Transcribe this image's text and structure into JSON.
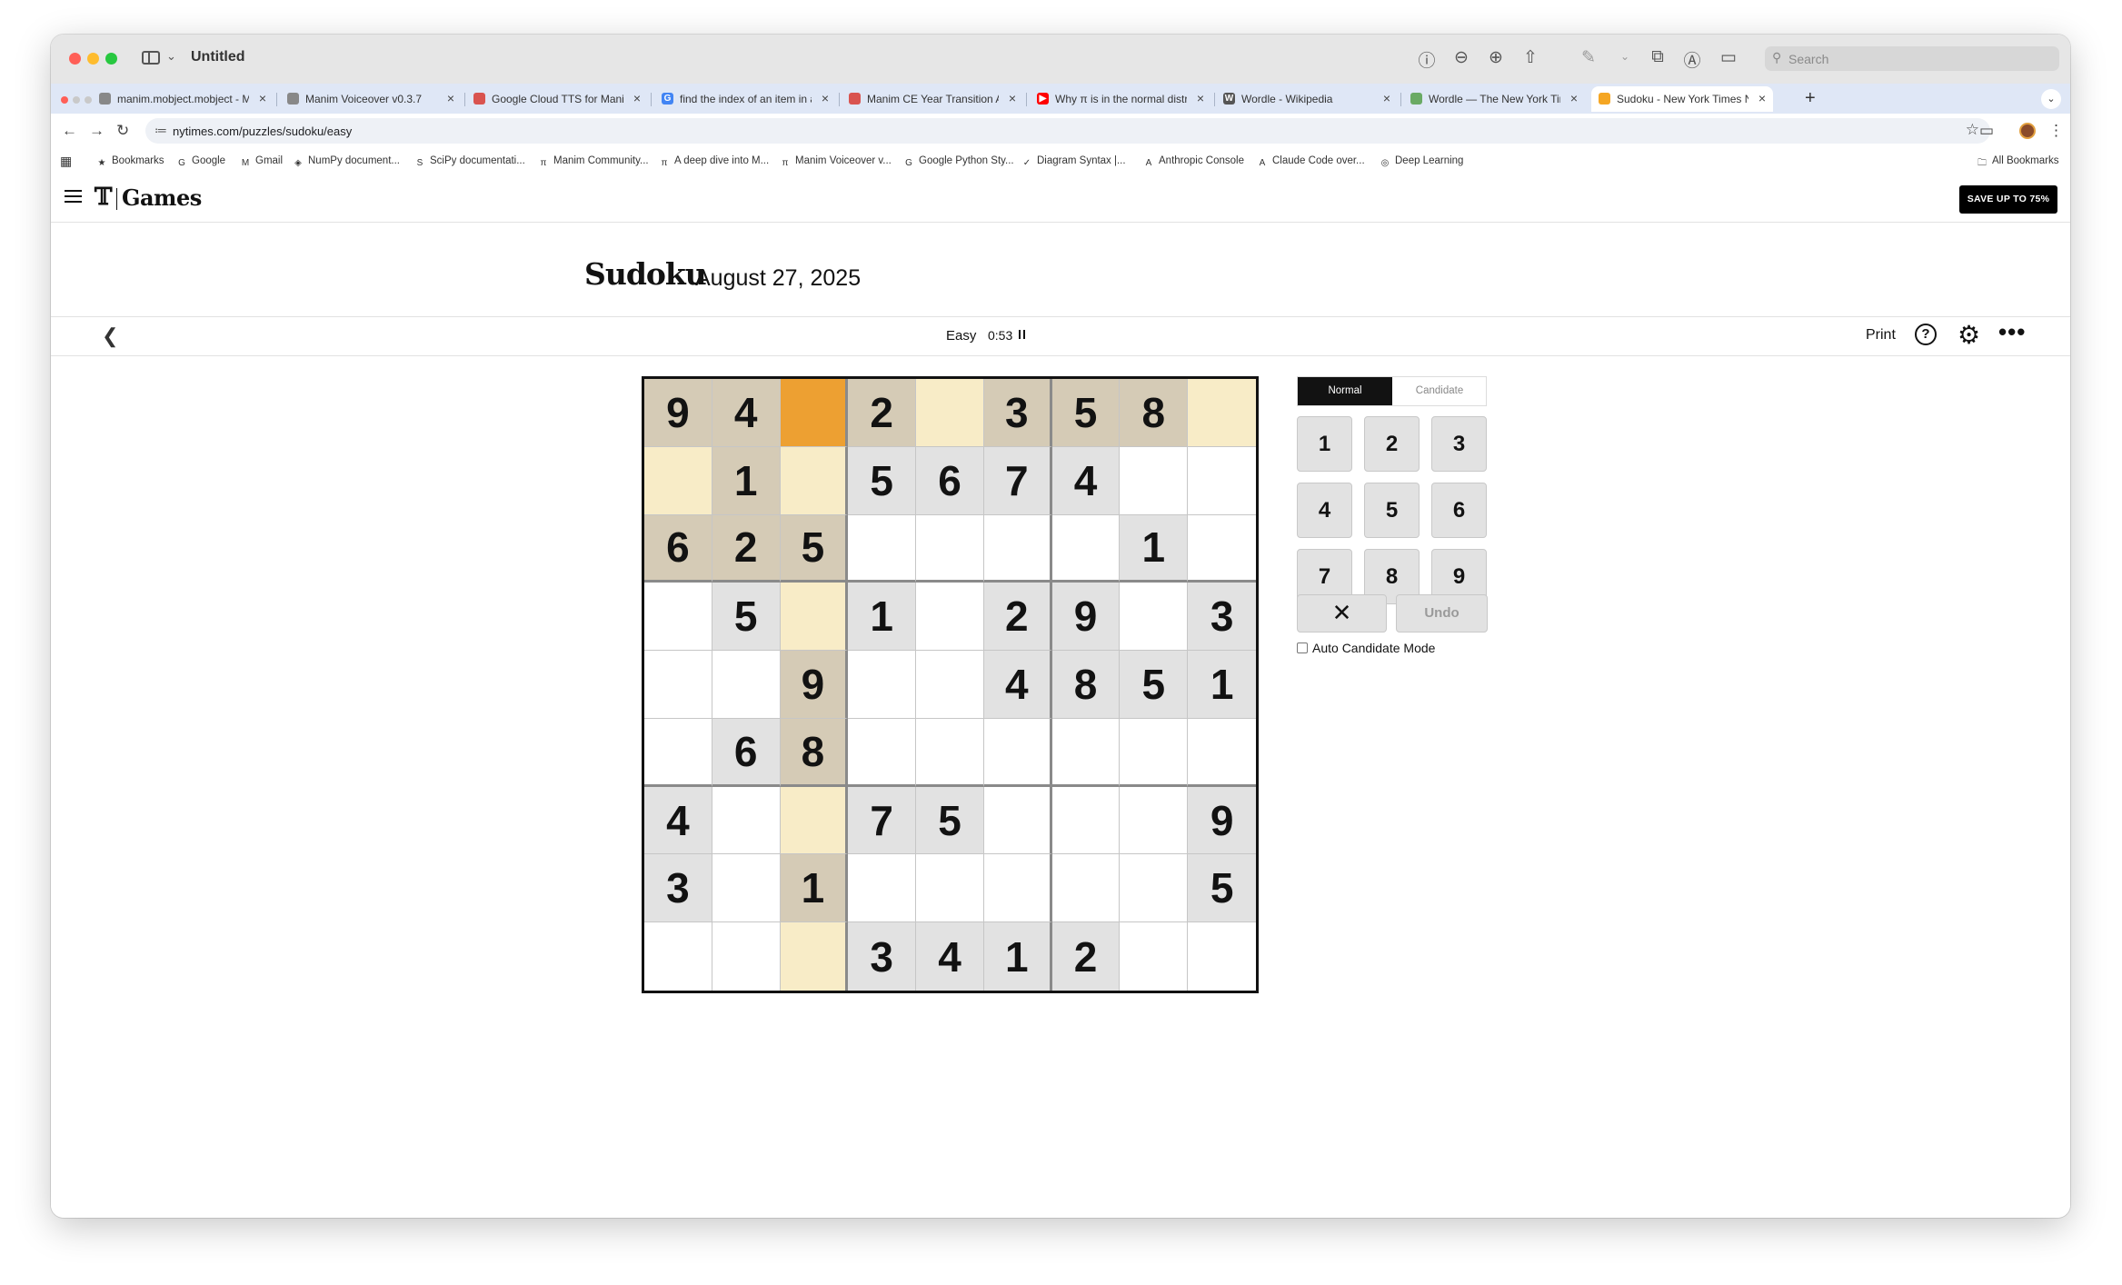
{
  "window": {
    "title": "Untitled",
    "search_placeholder": "Search"
  },
  "tabs": [
    {
      "label": "manim.mobject.mobject - Ma",
      "fav": "",
      "favcolor": "#888888",
      "active": false
    },
    {
      "label": "Manim Voiceover v0.3.7",
      "fav": "",
      "favcolor": "#888888",
      "active": false
    },
    {
      "label": "Google Cloud TTS for Manim",
      "fav": "",
      "favcolor": "#d9534f",
      "active": false
    },
    {
      "label": "find the index of an item in a",
      "fav": "G",
      "favcolor": "#4285f4",
      "active": false
    },
    {
      "label": "Manim CE Year Transition An",
      "fav": "",
      "favcolor": "#d9534f",
      "active": false
    },
    {
      "label": "Why π is in the normal distrib",
      "fav": "▶",
      "favcolor": "#ff0000",
      "active": false
    },
    {
      "label": "Wordle - Wikipedia",
      "fav": "W",
      "favcolor": "#555555",
      "active": false
    },
    {
      "label": "Wordle — The New York Times",
      "fav": "",
      "favcolor": "#6aaa64",
      "active": false
    },
    {
      "label": "Sudoku - New York Times Nu",
      "fav": "",
      "favcolor": "#f5a623",
      "active": true
    }
  ],
  "address": {
    "url": "nytimes.com/puzzles/sudoku/easy"
  },
  "bookmarks": [
    {
      "label": "Bookmarks",
      "icon": "★"
    },
    {
      "label": "Google",
      "icon": "G"
    },
    {
      "label": "Gmail",
      "icon": "M"
    },
    {
      "label": "NumPy document...",
      "icon": "◈"
    },
    {
      "label": "SciPy documentati...",
      "icon": "S"
    },
    {
      "label": "Manim Community...",
      "icon": "π"
    },
    {
      "label": "A deep dive into M...",
      "icon": "π"
    },
    {
      "label": "Manim Voiceover v...",
      "icon": "π"
    },
    {
      "label": "Google Python Sty...",
      "icon": "G"
    },
    {
      "label": "Diagram Syntax |...",
      "icon": "✓"
    },
    {
      "label": "Anthropic Console",
      "icon": "A"
    },
    {
      "label": "Claude Code over...",
      "icon": "A"
    },
    {
      "label": "Deep Learning",
      "icon": "◎"
    }
  ],
  "all_bookmarks": "All Bookmarks",
  "site": {
    "logo": "𝕋",
    "games": "Games",
    "promo": "SAVE UP TO 75%"
  },
  "puzzle": {
    "title": "Sudoku",
    "date": "August 27, 2025",
    "difficulty": "Easy",
    "timer": "0:53",
    "print": "Print",
    "help": "?"
  },
  "grid": [
    [
      "9",
      "4",
      "",
      "2",
      "",
      "3",
      "5",
      "8",
      ""
    ],
    [
      "",
      "1",
      "",
      "5",
      "6",
      "7",
      "4",
      "",
      ""
    ],
    [
      "6",
      "2",
      "5",
      "",
      "",
      "",
      "",
      "1",
      ""
    ],
    [
      "",
      "5",
      "",
      "1",
      "",
      "2",
      "9",
      "",
      "3"
    ],
    [
      "",
      "",
      "9",
      "",
      "",
      "4",
      "8",
      "5",
      "1"
    ],
    [
      "",
      "6",
      "8",
      "",
      "",
      "",
      "",
      "",
      ""
    ],
    [
      "4",
      "",
      "",
      "7",
      "5",
      "",
      "",
      "",
      "9"
    ],
    [
      "3",
      "",
      "1",
      "",
      "",
      "",
      "",
      "",
      "5"
    ],
    [
      "",
      "",
      "",
      "3",
      "4",
      "1",
      "2",
      "",
      ""
    ]
  ],
  "selected_cell": {
    "row": 0,
    "col": 2
  },
  "colors": {
    "selected": "#eda032",
    "highlight": "#f8ecc7",
    "highlight_given": "#d5cbb6",
    "given": "#e2e2e2"
  },
  "panel": {
    "mode_normal": "Normal",
    "mode_candidate": "Candidate",
    "keys": [
      "1",
      "2",
      "3",
      "4",
      "5",
      "6",
      "7",
      "8",
      "9"
    ],
    "erase": "✕",
    "undo": "Undo",
    "auto_candidate": "Auto Candidate Mode"
  }
}
